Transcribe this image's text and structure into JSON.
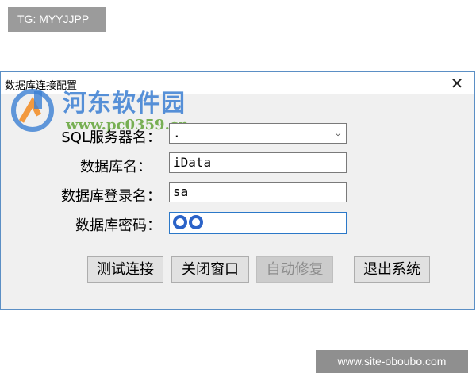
{
  "tag_top": "TG: MYYJJPP",
  "tag_bottom": "www.site-oboubo.com",
  "dialog": {
    "title": "数据库连接配置",
    "close_glyph": "✕",
    "watermark": {
      "name": "河东软件园",
      "url": "www.pc0359.cn"
    },
    "fields": {
      "server": {
        "label": "SQL服务器名：",
        "value": ".",
        "arrow": "⌵"
      },
      "database": {
        "label": "数据库名：",
        "value": "iData"
      },
      "login": {
        "label": "数据库登录名：",
        "value": "sa"
      },
      "password": {
        "label": "数据库密码：",
        "masked_chars": 2
      }
    },
    "buttons": {
      "test": "测试连接",
      "close": "关闭窗口",
      "repair": "自动修复",
      "exit": "退出系统"
    }
  },
  "colors": {
    "accent": "#2b78c8",
    "dialog_bg": "#f0f0f0",
    "watermark_blue": "#3b7fd3",
    "watermark_green": "#5aa02c"
  }
}
